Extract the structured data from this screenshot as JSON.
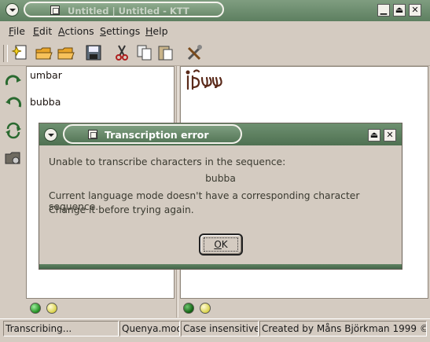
{
  "window": {
    "title": "Untitled | Untitled - KTT"
  },
  "menu": [
    {
      "pre": "",
      "u": "F",
      "post": "ile"
    },
    {
      "pre": "",
      "u": "E",
      "post": "dit"
    },
    {
      "pre": "",
      "u": "A",
      "post": "ctions"
    },
    {
      "pre": "",
      "u": "S",
      "post": "ettings"
    },
    {
      "pre": "",
      "u": "H",
      "post": "elp"
    }
  ],
  "toolbar": [
    "new-file-icon",
    "open-folder-icon",
    "open-recent-folder-icon",
    "save-disk-icon",
    "cut-scissors-icon",
    "copy-icon",
    "paste-icon",
    "tools-icon"
  ],
  "sidebar": [
    "transcribe-icon",
    "reverse-transcribe-icon",
    "swap-icon",
    "settings-folder-icon"
  ],
  "editor": {
    "lines": [
      "umbar",
      "bubba"
    ]
  },
  "dialog": {
    "title": "Transcription error",
    "line1": "Unable to transcribe characters in the sequence:",
    "sequence": "bubba",
    "line2": "Current language mode doesn't have a corresponding character sequence.",
    "line3": "Change it before trying again.",
    "ok_pre": "",
    "ok_u": "O",
    "ok_post": "K"
  },
  "statusbar": {
    "status": "Transcribing...",
    "mode_file": "Quenya.mod",
    "case": "Case insensitive",
    "credits": "Created by Måns Björkman 1999 ©"
  },
  "colors": {
    "titlebar": "#6e8f70",
    "background": "#d4cbc1",
    "tengwar_text": "#5a2a1a"
  }
}
